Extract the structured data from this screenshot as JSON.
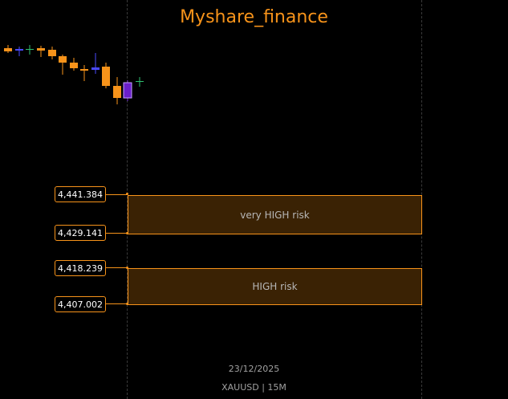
{
  "header": {
    "title": "Myshare_finance"
  },
  "colors": {
    "accent": "#f7931a",
    "zone_fill": "#3a2204",
    "bull_candle": "#4a4aff",
    "bear_candle": "#f7931a",
    "last_candle": "#6a1fc9",
    "doji": "#2fbf71",
    "background": "#000000"
  },
  "zones": [
    {
      "label": "very HIGH risk",
      "upper_price": "4,441.384",
      "lower_price": "4,429.141"
    },
    {
      "label": "HIGH risk",
      "upper_price": "4,418.239",
      "lower_price": "4,407.002"
    }
  ],
  "footer": {
    "date": "23/12/2025",
    "symbol": "XAUUSD | 15M"
  }
}
